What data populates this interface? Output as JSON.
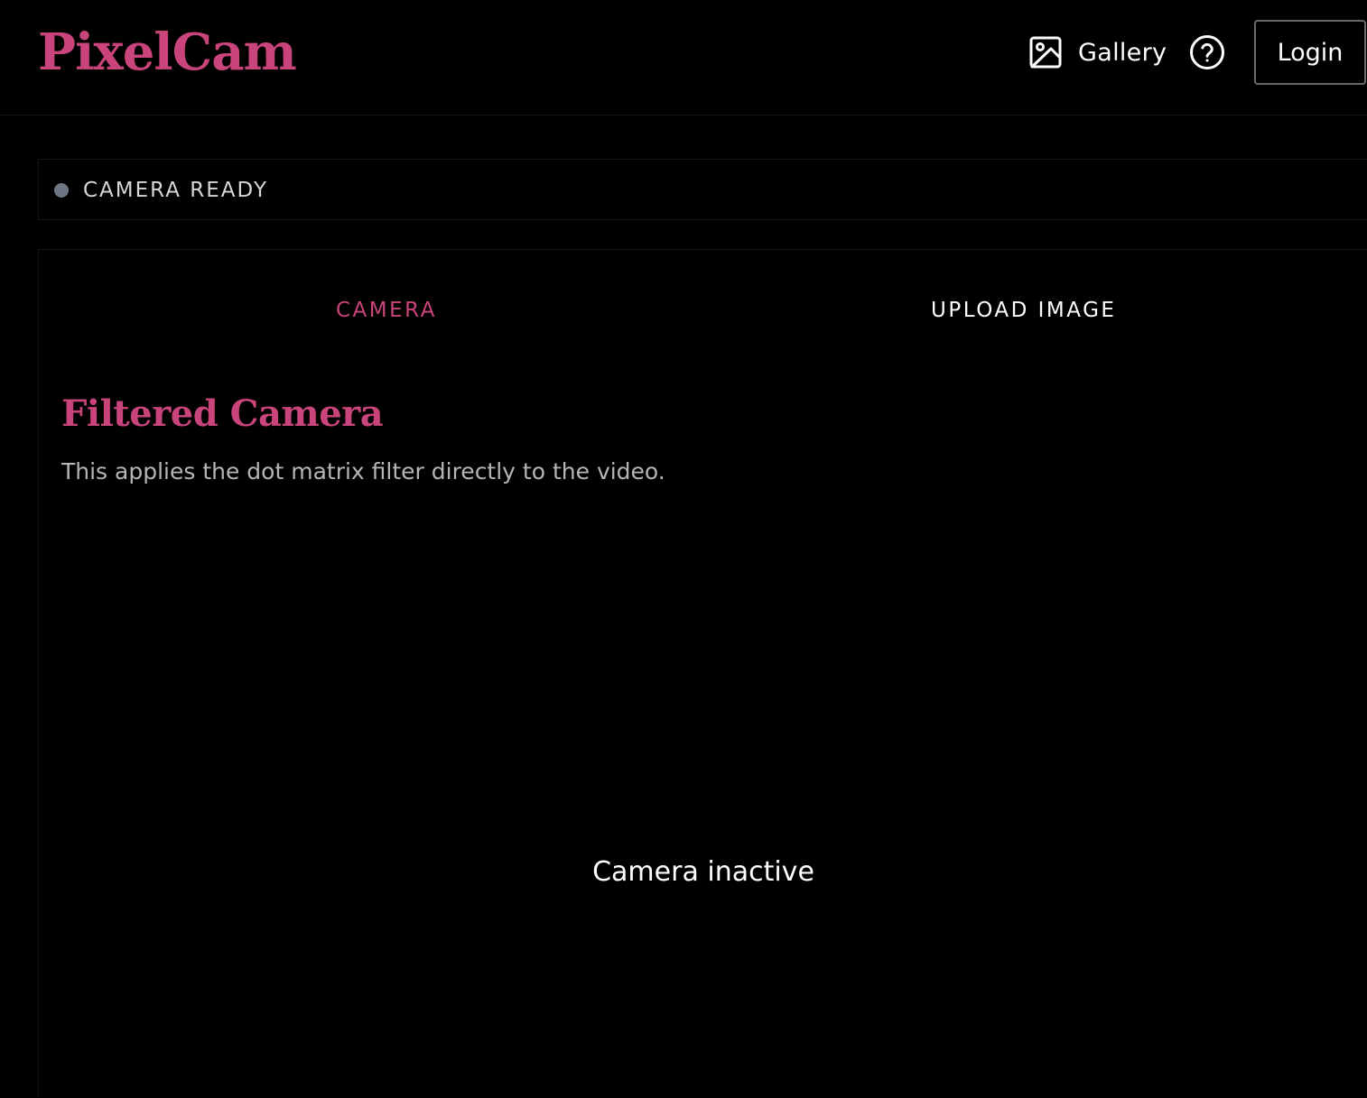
{
  "header": {
    "logo": "PixelCam",
    "nav": {
      "gallery_label": "Gallery",
      "gallery_icon": "image-icon",
      "help_icon": "help-circle-icon"
    },
    "login_label": "Login"
  },
  "status": {
    "text": "CAMERA READY",
    "dot_color": "#6F7584"
  },
  "tabs": [
    {
      "label": "CAMERA",
      "active": true
    },
    {
      "label": "UPLOAD IMAGE",
      "active": false
    }
  ],
  "camera_section": {
    "title": "Filtered Camera",
    "description": "This applies the dot matrix filter directly to the video.",
    "view_status": "Camera inactive"
  },
  "colors": {
    "accent": "#C9447A",
    "background": "#000000",
    "text": "#FFFFFF",
    "muted_text": "#B5B5B5"
  }
}
